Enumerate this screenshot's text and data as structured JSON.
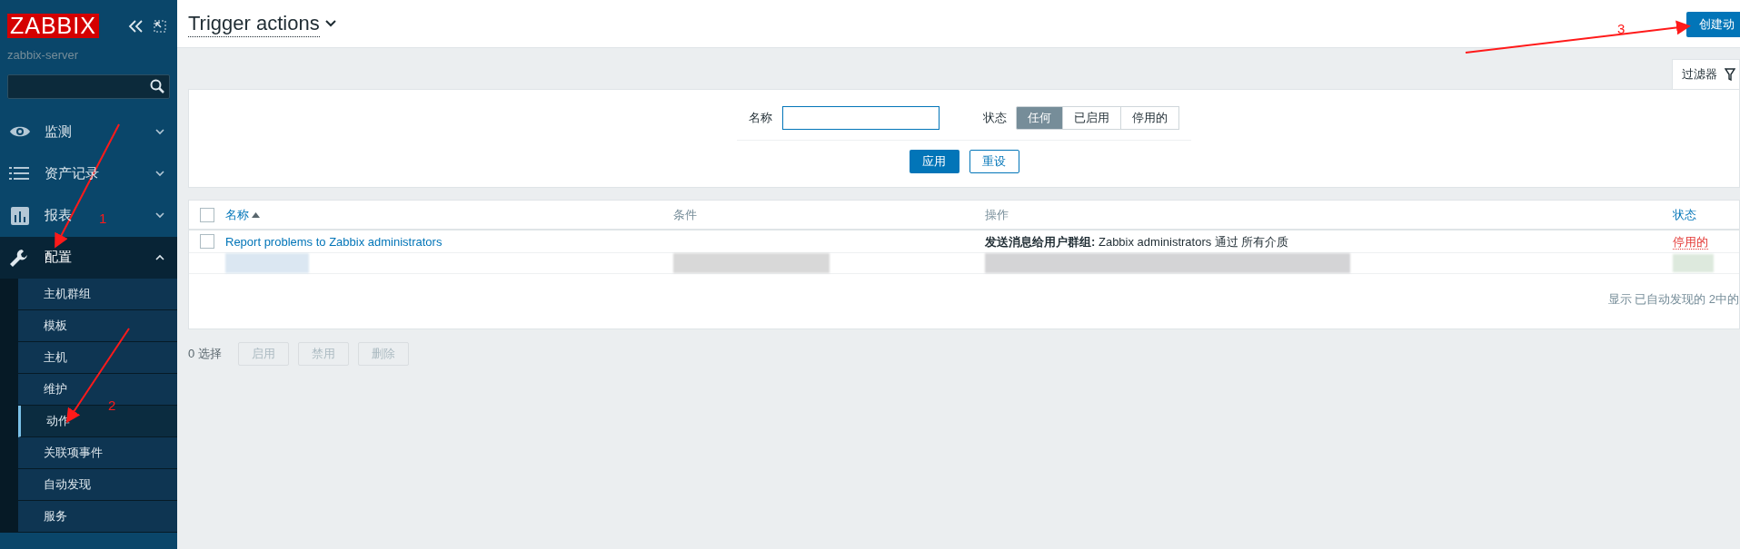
{
  "sidebar": {
    "logo": "ZABBIX",
    "server": "zabbix-server",
    "items": [
      {
        "label": "监测",
        "expanded": false,
        "selected": false
      },
      {
        "label": "资产记录",
        "expanded": false,
        "selected": false
      },
      {
        "label": "报表",
        "expanded": false,
        "selected": false
      },
      {
        "label": "配置",
        "expanded": true,
        "selected": true,
        "children": [
          {
            "label": "主机群组",
            "selected": false
          },
          {
            "label": "模板",
            "selected": false
          },
          {
            "label": "主机",
            "selected": false
          },
          {
            "label": "维护",
            "selected": false
          },
          {
            "label": "动作",
            "selected": true
          },
          {
            "label": "关联项事件",
            "selected": false
          },
          {
            "label": "自动发现",
            "selected": false
          },
          {
            "label": "服务",
            "selected": false
          }
        ]
      }
    ]
  },
  "header": {
    "title": "Trigger actions",
    "create_button": "创建动"
  },
  "filter": {
    "tab": "过滤器",
    "name_label": "名称",
    "status_label": "状态",
    "status_options": [
      {
        "label": "任何",
        "selected": true
      },
      {
        "label": "已启用",
        "selected": false
      },
      {
        "label": "停用的",
        "selected": false
      }
    ],
    "apply": "应用",
    "reset": "重设"
  },
  "table": {
    "select_all": {
      "checked": false
    },
    "columns": [
      {
        "label": "名称",
        "sorted": true
      },
      {
        "label": "条件",
        "sorted": false
      },
      {
        "label": "操作",
        "sorted": false
      },
      {
        "label": "状态",
        "sorted": false
      }
    ],
    "rows": [
      {
        "kind": "action",
        "checked": false,
        "name": "Report problems to Zabbix administrators",
        "conditions": "",
        "operations": "**发送消息给用户群组:** Zabbix administrators 通过 所有介质",
        "status": "停用的",
        "enabled": false
      },
      {
        "kind": "redacted"
      }
    ],
    "footer": "显示 已自动发现的 2中的"
  },
  "actions": {
    "selected_count": "0 选择",
    "buttons": [
      {
        "label": "启用",
        "disabled": true
      },
      {
        "label": "禁用",
        "disabled": true
      },
      {
        "label": "删除",
        "disabled": true
      }
    ]
  },
  "annotations": [
    {
      "label": "1"
    },
    {
      "label": "2"
    },
    {
      "label": "3"
    }
  ]
}
